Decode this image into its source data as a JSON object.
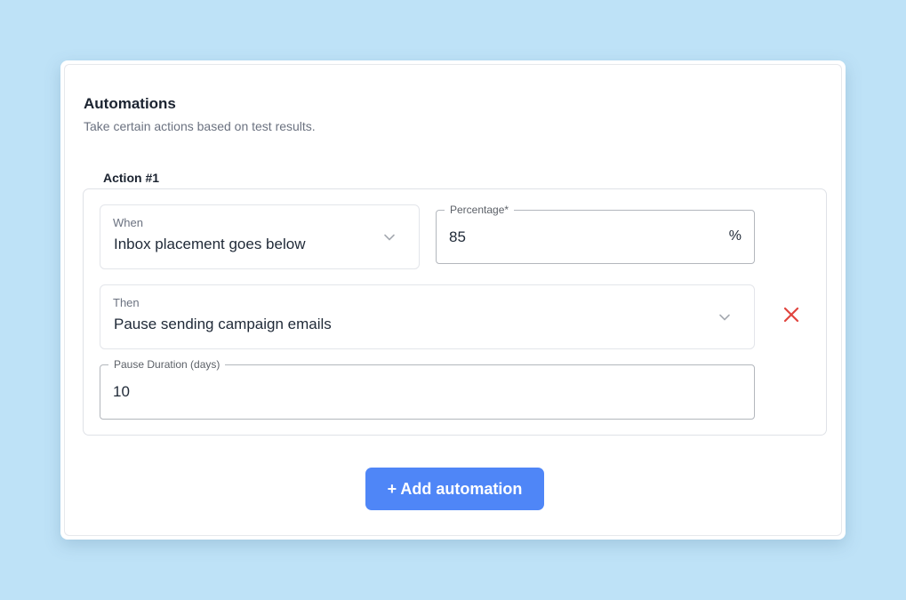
{
  "section": {
    "title": "Automations",
    "subtitle": "Take certain actions based on test results."
  },
  "action": {
    "label": "Action #1",
    "when": {
      "label": "When",
      "value": "Inbox placement goes below"
    },
    "percentage": {
      "label": "Percentage*",
      "value": "85",
      "suffix": "%"
    },
    "then": {
      "label": "Then",
      "value": "Pause sending campaign emails"
    },
    "pause_duration": {
      "label": "Pause Duration (days)",
      "value": "10"
    }
  },
  "add_button": {
    "label": "+ Add automation"
  },
  "icons": {
    "chevron": "chevron-down-icon",
    "remove": "close-icon"
  },
  "colors": {
    "background": "#bee2f7",
    "accent": "#4f86f7",
    "danger": "#e0443e"
  }
}
